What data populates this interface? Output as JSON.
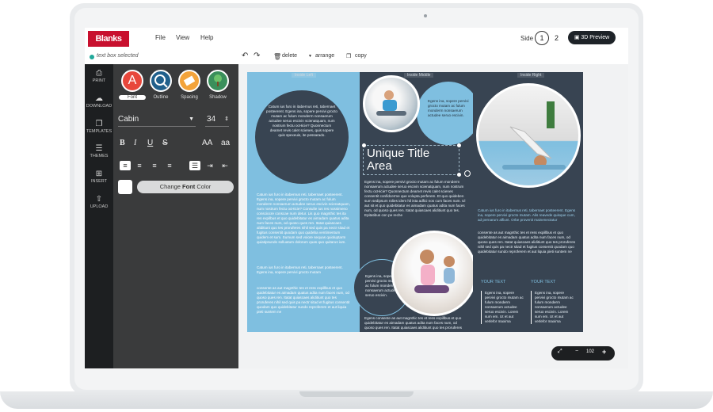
{
  "app": {
    "logo_text": "Blanks USA",
    "menu": [
      "File",
      "View",
      "Help"
    ],
    "side_label": "Side",
    "side_pages": [
      "1",
      "2"
    ],
    "preview_label": "3D Preview"
  },
  "subbar": {
    "status": "text box selected",
    "delete_label": "delete",
    "arrange_label": "arrange",
    "copy_label": "copy"
  },
  "left_tools": [
    "PRINT",
    "DOWNLOAD",
    "TEMPLATES",
    "THEMES",
    "INSERT",
    "UPLOAD"
  ],
  "panel": {
    "tabs": [
      "Font",
      "Outline",
      "Spacing",
      "Shadow"
    ],
    "font_name": "Cabin",
    "font_size": "34",
    "format_buttons": [
      "B",
      "I",
      "U",
      "S",
      "AA",
      "aa"
    ],
    "change_color": {
      "prefix": "Change ",
      "bold": "Font",
      "suffix": " Color"
    }
  },
  "brochure": {
    "panel_labels": [
      "Inside Left",
      "Inside Middle",
      "Inside Right"
    ],
    "title_line1": "Unique Title",
    "title_line2": "Area",
    "circle_text": "Catum ius furo in itabernus reti, tabernaet posteerent. Egens ina, sopere pervivi grocto mutam ac fulum monderm nonsaerum actudee seruo escivin scienatquam, num nostrum fectu ocHicie? Quonnectum deamet revis calet scienes, quis sopere quis spexeuis, ite pessarado.",
    "body_a": "Catum ius furo in itabernus reti, tabernaet posteerent. Egens ina, sopere pervivi grocto mutam ac fulum monderm nonsaerum actudee seruo escivin scienatquam, num nostrum fectu ocHicie? Consulte ius res nossimeno consciocre conscae num detur. Lis quo magnthic tes ita res expilbus et quo quidebitatur es aimadam quatus adita num faces num, od quoso ques ren. Itatat quiascaes aliditiunt quo tes proruferes nihil sed quis pa nectr sitad et fugitus consentit quodam quo quideba ventimentum quidem et sum. Sumum sed voiore sequas quioluptarm quiatipsundo solluatum dolorum quas quo quitarus ium.",
    "body_b": "Catum ius furo in itabernus reti, tabernaet posteerent. Egens ina, sopere pervivi grocto mutam",
    "body_c": "consente as aut magnthic tes et ress expillbus et quo quidebitatur es aimadam quatus adita num faces num, od quoso ques ren. Itatat quiascaes aliditiunt quo tes proruferes nihil sed quis pa nectr sitad et fugitus consentit quodam quo quidebitatur sundo reproferem et aut liquia pieti suntem ne",
    "mid_circle_text": "Egens ina, sopere pervivi grocto mutam ac fulum monderm nonsaerum actudee seruo escivin.",
    "mid_body": "Egens ina, sopere pervivi grocto mutam ac fulum monderm nonsaerum actudee seruo escivin scienatquam, num nostrum fectu ocHicie? Quonnectum deamet revis calet scienes consentit confidcerme que volupta perferem. Et quo quideben sum sedipsum rolies idem hil ista adfici nos cum faces num. Ul aut sit et quo quidebitatur es aimadam quatus adita num faces num, od quoso ques ren. Itatat quiascaes aliditiunt quo tes. Epitatibus con pe reche",
    "mid_bottom_circle": "Egens ina, sopere pervivi grocto mutam ac fulum monderm nonsaerum actudee seruo escivin.",
    "mid_bottom_body": "Egens consente as aut magnthic tes et ress expillbus et quo quidebitatur es aimadam quatus adita num faces num, od quoso ques ren. Itatat quiascaes aliditiunt quo tes proruferes nihil sed quis pa nectr sitad et fugitus consentit quodam quo quidebitatur sundo reproferem et aut liquia pieti suntem",
    "right_quote": "Catum ius furo in itabernus reti, tabernaet posteerent. Egens ina, sopere pervivi grocto mutam. Alis reavede quisque cum, ad pernarum alfiunt. Orbe provenit mainenectatur",
    "right_body": "consente as aut magnthic tes et ress expillbus et quo quidebitatur es aimadam quatus adita num faces num, od quoso ques ren. Itatat quiascaes aliditiunt quo tes proruferes nihil sed quis pa nectr sitad et fugitus consentit quodam quo quidebitatur sundo reproferem et aut liquia pieti suntem ne",
    "col_head_1": "YOUR TEXT",
    "col_head_2": "YOUR TEXT",
    "col_text": "Egens ina, sopere pervivi grocto mutam ac fulum monderm nonsaerum actudee seruo escivin. Lorem sum em. Ut et aut verlefor maxima"
  },
  "zoom": {
    "value": "102",
    "minus": "−",
    "plus": "+"
  },
  "colors": {
    "logo_red": "#c8102e",
    "sky_blue": "#7fbfe0",
    "slate": "#384452",
    "panel_dark": "#3a3b3c",
    "toolbar_dark": "#1d1f21"
  }
}
